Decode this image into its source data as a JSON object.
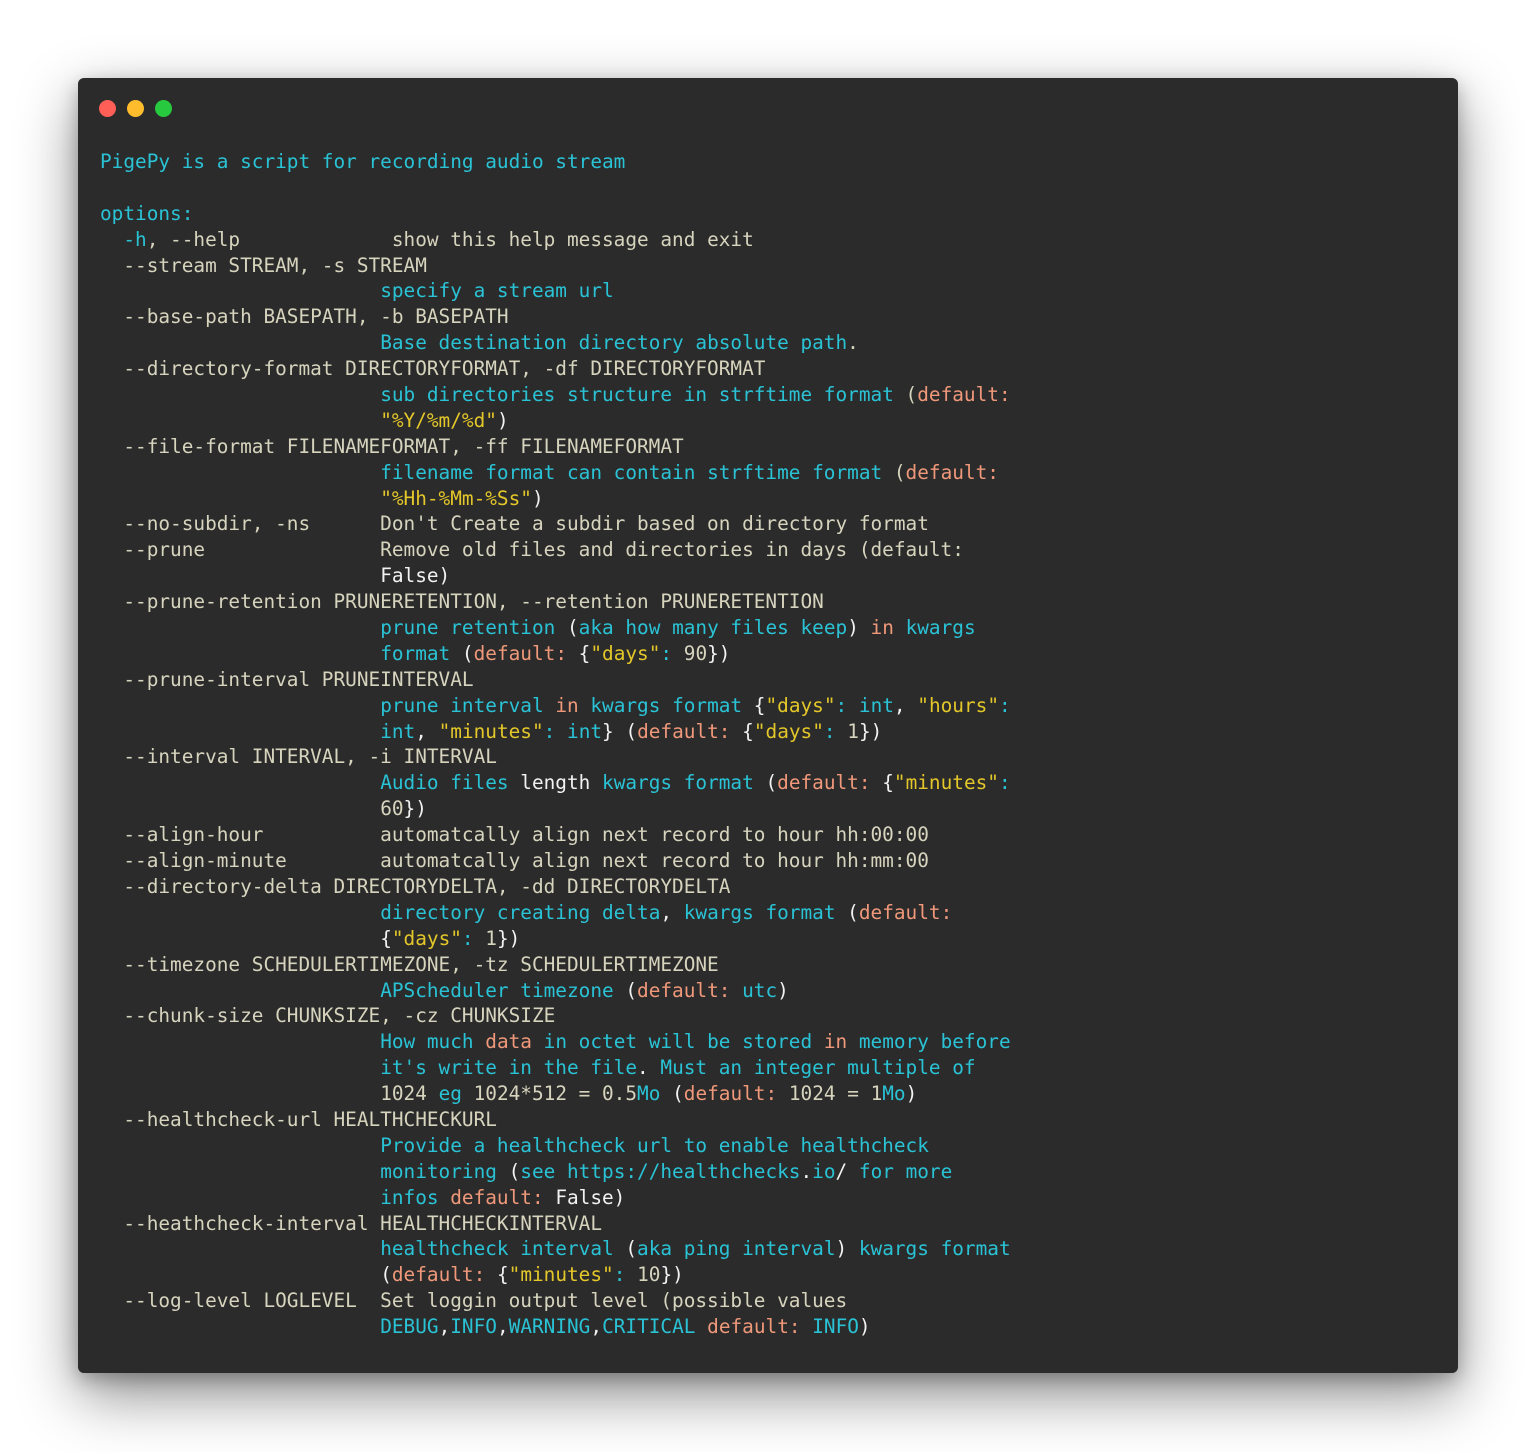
{
  "window": {
    "colors": {
      "background": "#2b2b2b",
      "dot_close": "#ff5f56",
      "dot_minimize": "#ffbd2e",
      "dot_maximize": "#27c93f",
      "text_default": "#d7d4be",
      "text_cyan": "#2ac3d6",
      "text_orange": "#f0987a",
      "text_yellow": "#e4c729",
      "text_white": "#f2f2f2"
    }
  },
  "terminal": {
    "lines": [
      [
        {
          "t": "PigePy is a script for recording audio stream",
          "s": "c"
        }
      ],
      [],
      [
        {
          "t": "options:",
          "s": "c"
        }
      ],
      [
        {
          "t": "  -h",
          "s": "c"
        },
        {
          "t": ", --help             ",
          "s": "n"
        },
        {
          "t": "show this help message and exit",
          "s": "n"
        }
      ],
      [
        {
          "t": "  --stream STREAM, -s STREAM",
          "s": "n"
        }
      ],
      [
        {
          "t": "                        ",
          "s": "n"
        },
        {
          "t": "specify a stream url",
          "s": "c"
        }
      ],
      [
        {
          "t": "  --base-path BASEPATH, -b BASEPATH",
          "s": "n"
        }
      ],
      [
        {
          "t": "                        ",
          "s": "n"
        },
        {
          "t": "Base destination directory absolute path",
          "s": "c"
        },
        {
          "t": ".",
          "s": "n"
        }
      ],
      [
        {
          "t": "  --directory-format DIRECTORYFORMAT, -df DIRECTORYFORMAT",
          "s": "n"
        }
      ],
      [
        {
          "t": "                        ",
          "s": "n"
        },
        {
          "t": "sub directories structure in strftime format",
          "s": "c"
        },
        {
          "t": " (",
          "s": "n"
        },
        {
          "t": "default:",
          "s": "o"
        }
      ],
      [
        {
          "t": "                        ",
          "s": "n"
        },
        {
          "t": "\"%Y/%m/%d\"",
          "s": "y"
        },
        {
          "t": ")",
          "s": "w"
        }
      ],
      [
        {
          "t": "  --file-format FILENAMEFORMAT, -ff FILENAMEFORMAT",
          "s": "n"
        }
      ],
      [
        {
          "t": "                        ",
          "s": "n"
        },
        {
          "t": "filename format can contain strftime format",
          "s": "c"
        },
        {
          "t": " (",
          "s": "n"
        },
        {
          "t": "default:",
          "s": "o"
        }
      ],
      [
        {
          "t": "                        ",
          "s": "n"
        },
        {
          "t": "\"%Hh-%Mm-%Ss\"",
          "s": "y"
        },
        {
          "t": ")",
          "s": "w"
        }
      ],
      [
        {
          "t": "  --no-subdir, -ns      Don't Create a subdir based on directory format",
          "s": "n"
        }
      ],
      [
        {
          "t": "  --prune               Remove old files and directories in days (default:",
          "s": "n"
        }
      ],
      [
        {
          "t": "                        ",
          "s": "n"
        },
        {
          "t": "False)",
          "s": "w"
        }
      ],
      [
        {
          "t": "  --prune-retention PRUNERETENTION, --retention PRUNERETENTION",
          "s": "n"
        }
      ],
      [
        {
          "t": "                        ",
          "s": "n"
        },
        {
          "t": "prune retention",
          "s": "c"
        },
        {
          "t": " (",
          "s": "w"
        },
        {
          "t": "aka how many files keep",
          "s": "c"
        },
        {
          "t": ") ",
          "s": "w"
        },
        {
          "t": "in",
          "s": "o"
        },
        {
          "t": " kwargs",
          "s": "c"
        }
      ],
      [
        {
          "t": "                        ",
          "s": "n"
        },
        {
          "t": "format",
          "s": "c"
        },
        {
          "t": " (",
          "s": "w"
        },
        {
          "t": "default:",
          "s": "o"
        },
        {
          "t": " {",
          "s": "w"
        },
        {
          "t": "\"days\"",
          "s": "y"
        },
        {
          "t": ": ",
          "s": "c"
        },
        {
          "t": "90",
          "s": "n"
        },
        {
          "t": "})",
          "s": "w"
        }
      ],
      [
        {
          "t": "  --prune-interval PRUNEINTERVAL",
          "s": "n"
        }
      ],
      [
        {
          "t": "                        ",
          "s": "n"
        },
        {
          "t": "prune interval",
          "s": "c"
        },
        {
          "t": " in",
          "s": "o"
        },
        {
          "t": " kwargs format",
          "s": "c"
        },
        {
          "t": " {",
          "s": "w"
        },
        {
          "t": "\"days\"",
          "s": "y"
        },
        {
          "t": ": ",
          "s": "c"
        },
        {
          "t": "int",
          "s": "c"
        },
        {
          "t": ", ",
          "s": "w"
        },
        {
          "t": "\"hours\"",
          "s": "y"
        },
        {
          "t": ":",
          "s": "c"
        }
      ],
      [
        {
          "t": "                        ",
          "s": "n"
        },
        {
          "t": "int",
          "s": "c"
        },
        {
          "t": ", ",
          "s": "w"
        },
        {
          "t": "\"minutes\"",
          "s": "y"
        },
        {
          "t": ": ",
          "s": "c"
        },
        {
          "t": "int",
          "s": "c"
        },
        {
          "t": "} (",
          "s": "w"
        },
        {
          "t": "default:",
          "s": "o"
        },
        {
          "t": " {",
          "s": "w"
        },
        {
          "t": "\"days\"",
          "s": "y"
        },
        {
          "t": ": ",
          "s": "c"
        },
        {
          "t": "1",
          "s": "n"
        },
        {
          "t": "})",
          "s": "w"
        }
      ],
      [
        {
          "t": "  --interval INTERVAL, -i INTERVAL",
          "s": "n"
        }
      ],
      [
        {
          "t": "                        ",
          "s": "n"
        },
        {
          "t": "Audio files",
          "s": "c"
        },
        {
          "t": " length ",
          "s": "w"
        },
        {
          "t": "kwargs format",
          "s": "c"
        },
        {
          "t": " (",
          "s": "w"
        },
        {
          "t": "default:",
          "s": "o"
        },
        {
          "t": " {",
          "s": "w"
        },
        {
          "t": "\"minutes\"",
          "s": "y"
        },
        {
          "t": ":",
          "s": "c"
        }
      ],
      [
        {
          "t": "                        ",
          "s": "n"
        },
        {
          "t": "60",
          "s": "n"
        },
        {
          "t": "})",
          "s": "w"
        }
      ],
      [
        {
          "t": "  --align-hour          automatcally align next record to hour hh:00:00",
          "s": "n"
        }
      ],
      [
        {
          "t": "  --align-minute        automatcally align next record to hour hh:mm:00",
          "s": "n"
        }
      ],
      [
        {
          "t": "  --directory-delta DIRECTORYDELTA, -dd DIRECTORYDELTA",
          "s": "n"
        }
      ],
      [
        {
          "t": "                        ",
          "s": "n"
        },
        {
          "t": "directory creating delta",
          "s": "c"
        },
        {
          "t": ", ",
          "s": "w"
        },
        {
          "t": "kwargs format",
          "s": "c"
        },
        {
          "t": " (",
          "s": "w"
        },
        {
          "t": "default:",
          "s": "o"
        }
      ],
      [
        {
          "t": "                        ",
          "s": "n"
        },
        {
          "t": "{",
          "s": "w"
        },
        {
          "t": "\"days\"",
          "s": "y"
        },
        {
          "t": ": ",
          "s": "c"
        },
        {
          "t": "1",
          "s": "n"
        },
        {
          "t": "})",
          "s": "w"
        }
      ],
      [
        {
          "t": "  --timezone SCHEDULERTIMEZONE, -tz SCHEDULERTIMEZONE",
          "s": "n"
        }
      ],
      [
        {
          "t": "                        ",
          "s": "n"
        },
        {
          "t": "APScheduler timezone",
          "s": "c"
        },
        {
          "t": " (",
          "s": "w"
        },
        {
          "t": "default:",
          "s": "o"
        },
        {
          "t": " utc",
          "s": "c"
        },
        {
          "t": ")",
          "s": "w"
        }
      ],
      [
        {
          "t": "  --chunk-size CHUNKSIZE, -cz CHUNKSIZE",
          "s": "n"
        }
      ],
      [
        {
          "t": "                        ",
          "s": "n"
        },
        {
          "t": "How much",
          "s": "c"
        },
        {
          "t": " data",
          "s": "o"
        },
        {
          "t": " in octet will be stored",
          "s": "c"
        },
        {
          "t": " in",
          "s": "o"
        },
        {
          "t": " memory before",
          "s": "c"
        }
      ],
      [
        {
          "t": "                        ",
          "s": "n"
        },
        {
          "t": "it's write in the file",
          "s": "c"
        },
        {
          "t": ". ",
          "s": "w"
        },
        {
          "t": "Must an integer multiple of",
          "s": "c"
        }
      ],
      [
        {
          "t": "                        ",
          "s": "n"
        },
        {
          "t": "1024",
          "s": "n"
        },
        {
          "t": " eg ",
          "s": "c"
        },
        {
          "t": "1024*512 = 0.5",
          "s": "n"
        },
        {
          "t": "Mo",
          "s": "c"
        },
        {
          "t": " (",
          "s": "w"
        },
        {
          "t": "default:",
          "s": "o"
        },
        {
          "t": " 1024 = 1",
          "s": "n"
        },
        {
          "t": "Mo",
          "s": "c"
        },
        {
          "t": ")",
          "s": "w"
        }
      ],
      [
        {
          "t": "  --healthcheck-url HEALTHCHECKURL",
          "s": "n"
        }
      ],
      [
        {
          "t": "                        ",
          "s": "n"
        },
        {
          "t": "Provide a healthcheck url to enable healthcheck",
          "s": "c"
        }
      ],
      [
        {
          "t": "                        ",
          "s": "n"
        },
        {
          "t": "monitoring",
          "s": "c"
        },
        {
          "t": " (",
          "s": "w"
        },
        {
          "t": "see https://healthchecks",
          "s": "c"
        },
        {
          "t": ".",
          "s": "w"
        },
        {
          "t": "io",
          "s": "c"
        },
        {
          "t": "/ ",
          "s": "w"
        },
        {
          "t": "for more",
          "s": "c"
        }
      ],
      [
        {
          "t": "                        ",
          "s": "n"
        },
        {
          "t": "infos",
          "s": "c"
        },
        {
          "t": " default:",
          "s": "o"
        },
        {
          "t": " False)",
          "s": "w"
        }
      ],
      [
        {
          "t": "  --heathcheck-interval HEALTHCHECKINTERVAL",
          "s": "n"
        }
      ],
      [
        {
          "t": "                        ",
          "s": "n"
        },
        {
          "t": "healthcheck interval",
          "s": "c"
        },
        {
          "t": " (",
          "s": "w"
        },
        {
          "t": "aka ping interval",
          "s": "c"
        },
        {
          "t": ") ",
          "s": "w"
        },
        {
          "t": "kwargs format",
          "s": "c"
        }
      ],
      [
        {
          "t": "                        ",
          "s": "n"
        },
        {
          "t": "(",
          "s": "w"
        },
        {
          "t": "default:",
          "s": "o"
        },
        {
          "t": " {",
          "s": "w"
        },
        {
          "t": "\"minutes\"",
          "s": "y"
        },
        {
          "t": ": ",
          "s": "c"
        },
        {
          "t": "10",
          "s": "n"
        },
        {
          "t": "})",
          "s": "w"
        }
      ],
      [
        {
          "t": "  --log-level LOGLEVEL  Set loggin output level (possible values",
          "s": "n"
        }
      ],
      [
        {
          "t": "                        ",
          "s": "n"
        },
        {
          "t": "DEBUG",
          "s": "c"
        },
        {
          "t": ",",
          "s": "w"
        },
        {
          "t": "INFO",
          "s": "c"
        },
        {
          "t": ",",
          "s": "w"
        },
        {
          "t": "WARNING",
          "s": "c"
        },
        {
          "t": ",",
          "s": "w"
        },
        {
          "t": "CRITICAL",
          "s": "c"
        },
        {
          "t": " default:",
          "s": "o"
        },
        {
          "t": " INFO",
          "s": "c"
        },
        {
          "t": ")",
          "s": "w"
        }
      ]
    ]
  }
}
